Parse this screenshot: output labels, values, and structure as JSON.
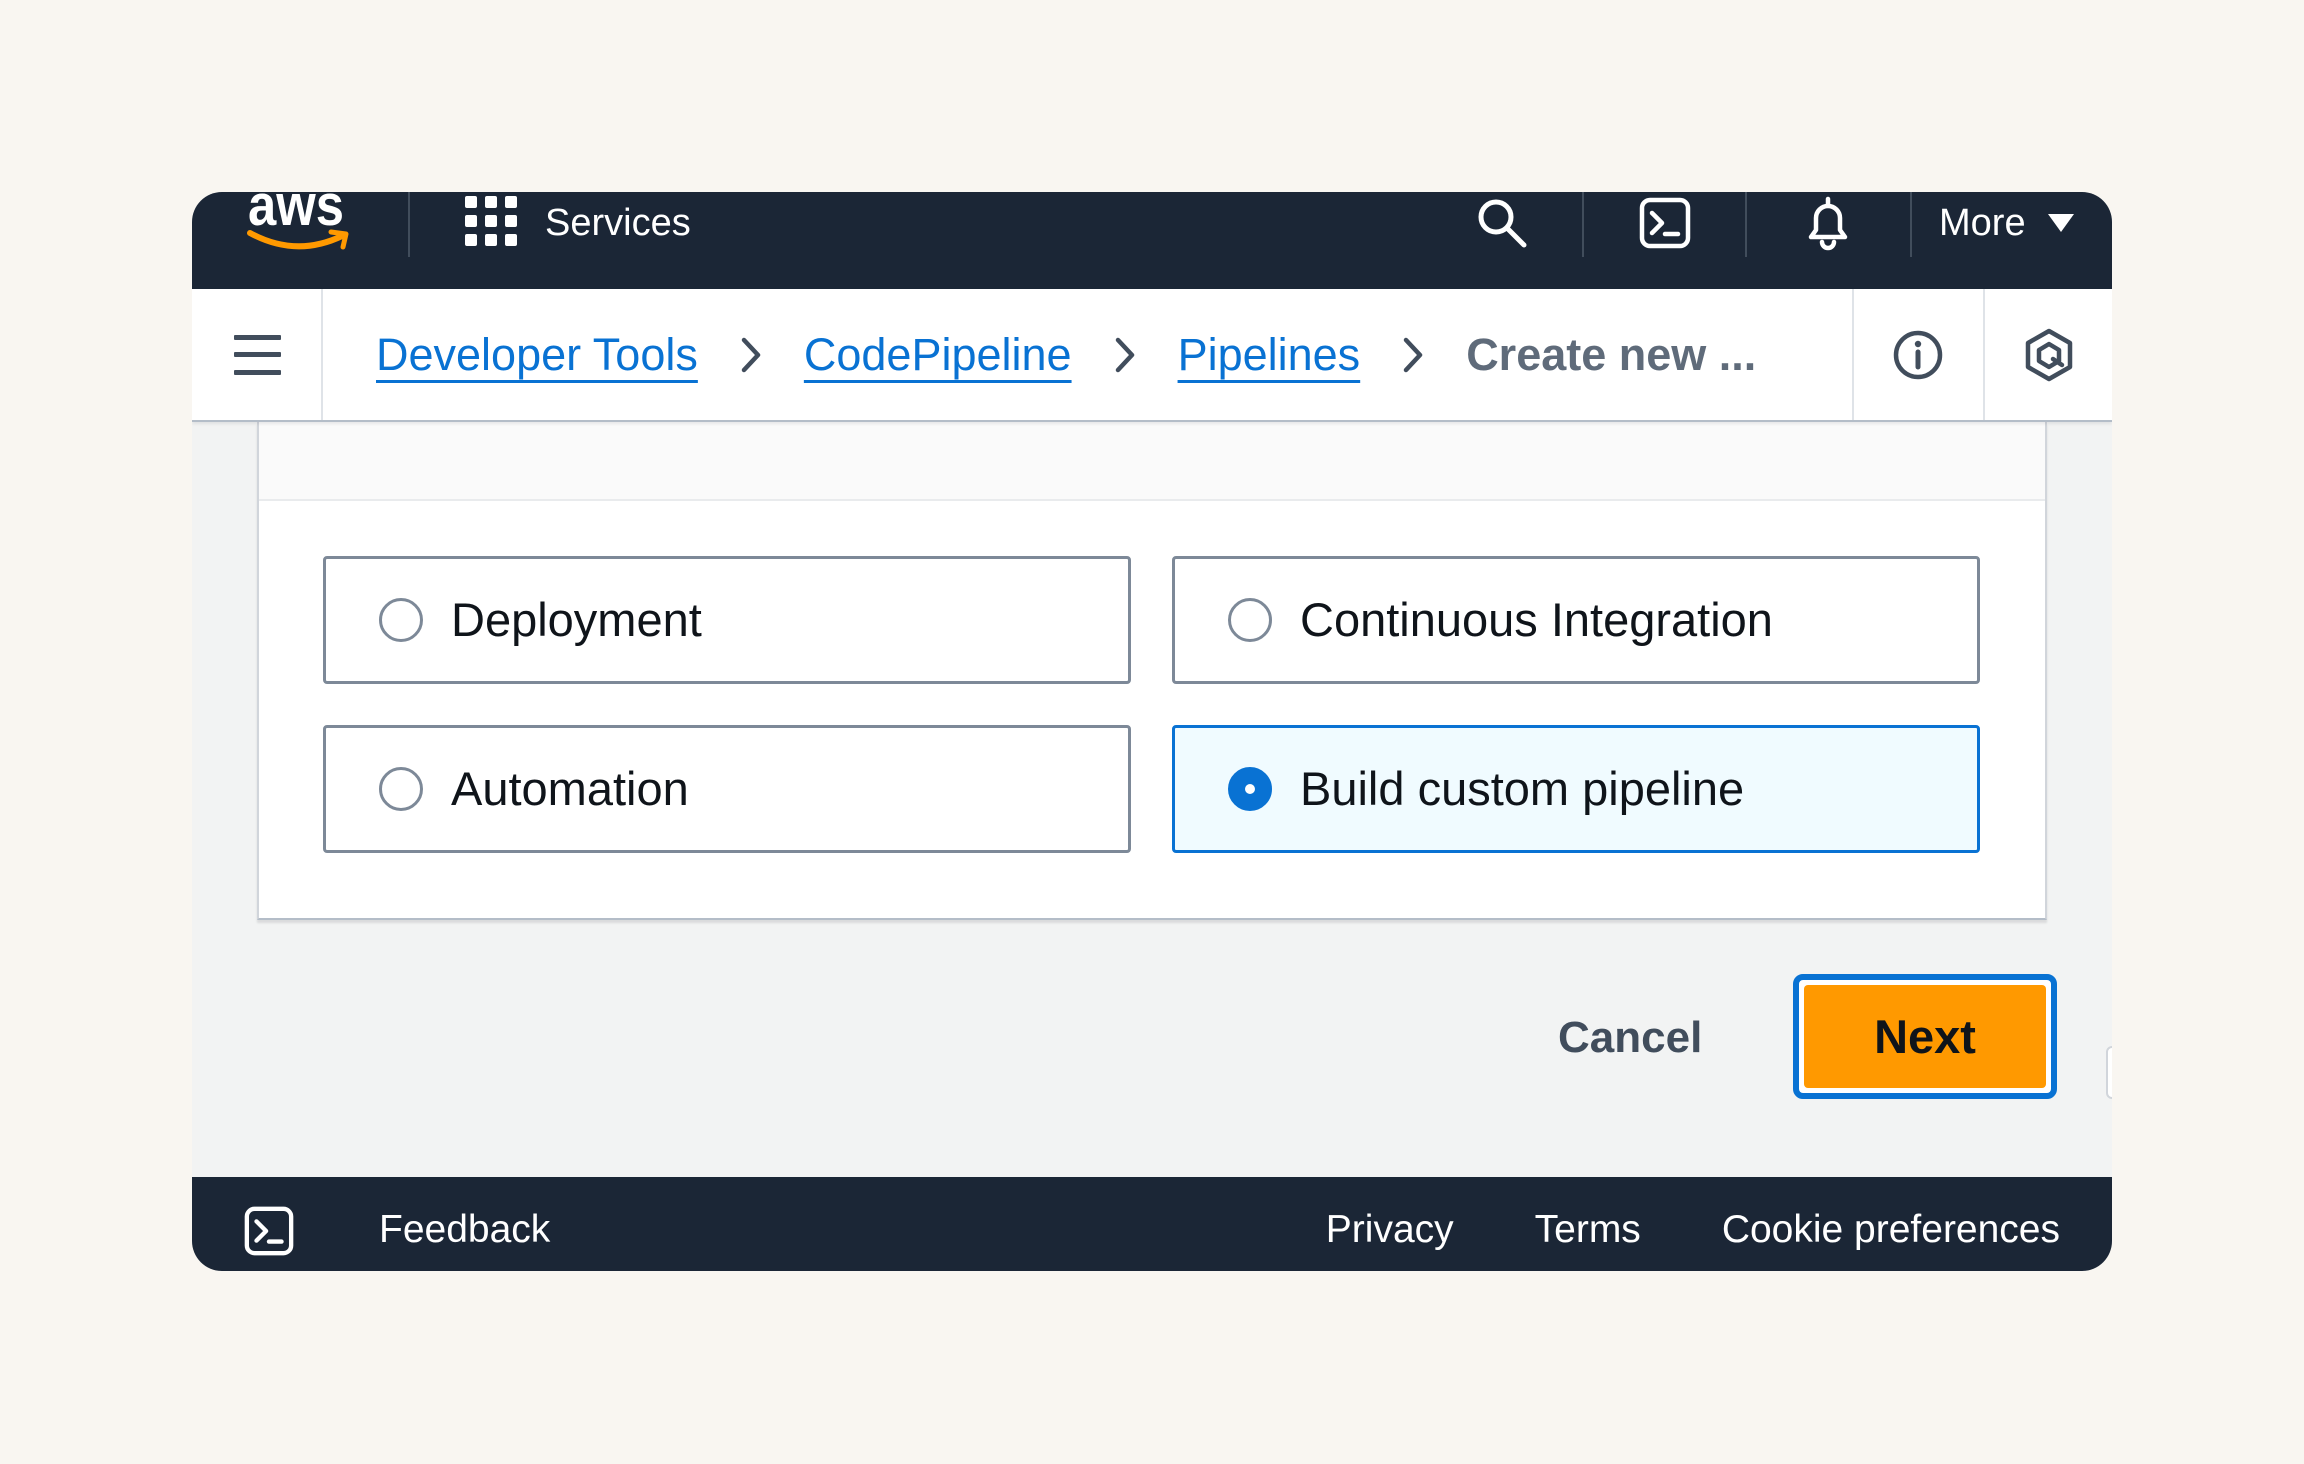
{
  "header": {
    "logo_text": "aws",
    "services_label": "Services",
    "more_label": "More"
  },
  "breadcrumb": {
    "items": [
      {
        "label": "Developer Tools"
      },
      {
        "label": "CodePipeline"
      },
      {
        "label": "Pipelines"
      },
      {
        "label": "Create new ..."
      }
    ]
  },
  "pipeline_type": {
    "options": [
      {
        "label": "Deployment",
        "selected": false
      },
      {
        "label": "Continuous Integration",
        "selected": false
      },
      {
        "label": "Automation",
        "selected": false
      },
      {
        "label": "Build custom pipeline",
        "selected": true
      }
    ]
  },
  "actions": {
    "cancel_label": "Cancel",
    "next_label": "Next"
  },
  "footer": {
    "feedback_label": "Feedback",
    "links": [
      "Privacy",
      "Terms",
      "Cookie preferences"
    ]
  },
  "icons": {
    "services": "grid-icon",
    "search": "search-icon",
    "cloudshell": "cloudshell-icon",
    "notifications": "bell-icon",
    "more": "caret-down-icon",
    "menu": "hamburger-menu-icon",
    "breadcrumb_separator": "chevron-right-icon",
    "info": "info-icon",
    "assistant": "hexagon-icon"
  },
  "colors": {
    "accent": "#0972d3",
    "header_bg": "#1b2636",
    "primary_button": "#ff9900",
    "selected_bg": "#f0fbff",
    "page_bg": "#f9f6f1",
    "content_bg": "#f2f3f3"
  }
}
